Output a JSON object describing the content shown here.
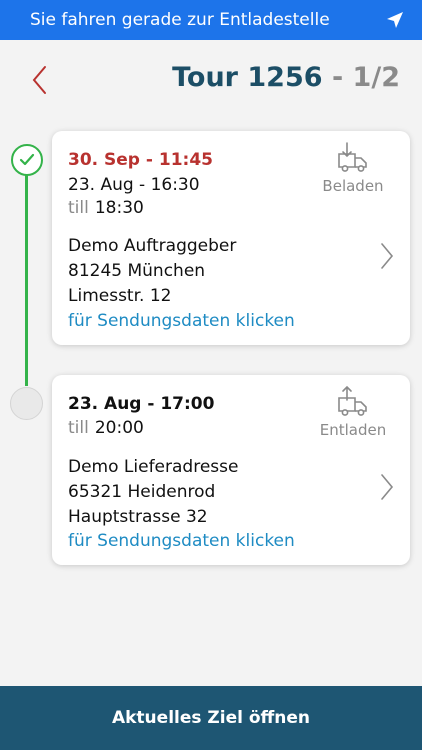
{
  "status_bar": {
    "message": "Sie fahren gerade zur Entladestelle",
    "icon": "navigation-arrow-icon"
  },
  "header": {
    "tour_label": "Tour 1256",
    "progress": " - 1/2"
  },
  "stops": [
    {
      "planned_time": "30. Sep - 11:45",
      "window_start": "23. Aug - 16:30",
      "till_label": "till",
      "window_end": "18:30",
      "status_label": "Beladen",
      "status_icon": "truck-download-icon",
      "name": "Demo Auftraggeber",
      "city": "81245 München",
      "street": "Limesstr. 12",
      "link": "für Sendungsdaten klicken",
      "done": true
    },
    {
      "planned_time": "23. Aug - 17:00",
      "till_label": "till",
      "window_end": "20:00",
      "status_label": "Entladen",
      "status_icon": "truck-upload-icon",
      "name": "Demo Lieferadresse",
      "city": "65321 Heidenrod",
      "street": "Hauptstrasse 32",
      "link": "für Sendungsdaten klicken",
      "done": false
    }
  ],
  "footer": {
    "button_label": "Aktuelles Ziel öffnen"
  },
  "colors": {
    "top_bar": "#1d74ea",
    "accent_green": "#34b34a",
    "accent_red": "#b8322f",
    "link": "#1e8bc3",
    "button": "#1e5673"
  }
}
